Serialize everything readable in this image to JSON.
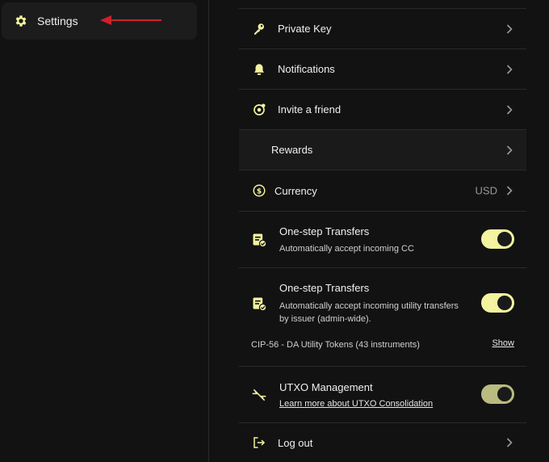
{
  "sidebar": {
    "items": [
      {
        "label": "Settings",
        "icon": "gear-icon"
      }
    ]
  },
  "annotation": {
    "color": "#d0202a"
  },
  "settings": {
    "private_key": {
      "label": "Private Key",
      "icon": "key-icon"
    },
    "notifications": {
      "label": "Notifications",
      "icon": "bell-icon"
    },
    "invite": {
      "label": "Invite a friend",
      "icon": "invite-icon"
    },
    "rewards": {
      "label": "Rewards"
    },
    "currency": {
      "label": "Currency",
      "value": "USD",
      "icon": "dollar-icon"
    },
    "transfers_cc": {
      "title": "One-step Transfers",
      "subtitle": "Automatically accept incoming CC",
      "enabled": true,
      "icon": "transfer-doc-icon"
    },
    "transfers_utility": {
      "title": "One-step Transfers",
      "subtitle_line1": "Automatically accept incoming utility transfers",
      "subtitle_line2": "by issuer (admin-wide).",
      "enabled": true,
      "footer_text": "CIP-56 - DA Utility Tokens (43 instruments)",
      "footer_action": "Show",
      "icon": "transfer-doc-icon"
    },
    "utxo": {
      "title": "UTXO Management",
      "link": "Learn more about UTXO Consolidation",
      "enabled": true,
      "icon": "merge-arrows-icon"
    },
    "logout": {
      "label": "Log out",
      "icon": "logout-icon"
    }
  },
  "colors": {
    "accent": "#f3f3a0",
    "background": "#121212"
  }
}
